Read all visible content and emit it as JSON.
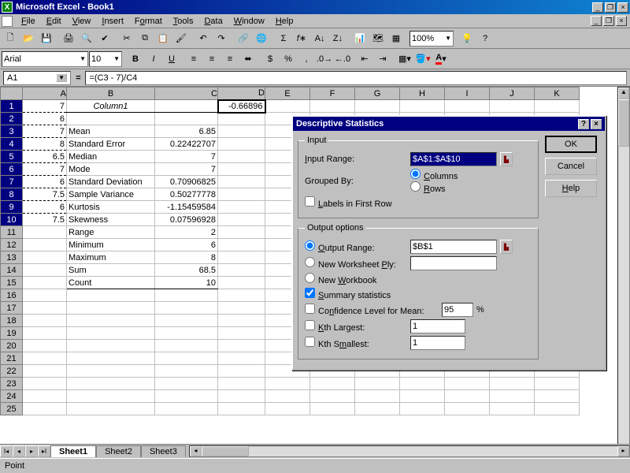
{
  "app": {
    "title": "Microsoft Excel - Book1"
  },
  "menu": {
    "file": "File",
    "edit": "Edit",
    "view": "View",
    "insert": "Insert",
    "format": "Format",
    "tools": "Tools",
    "data": "Data",
    "window": "Window",
    "help": "Help"
  },
  "font": {
    "name": "Arial",
    "size": "10"
  },
  "zoom": "100%",
  "namebox": "A1",
  "formula": "=(C3 - 7)/C4",
  "columns": [
    "A",
    "B",
    "C",
    "D",
    "E",
    "F",
    "G",
    "H",
    "I",
    "J",
    "K"
  ],
  "cells": {
    "A1": "7",
    "A2": "6",
    "A3": "7",
    "A4": "8",
    "A5": "6.5",
    "A6": "7",
    "A7": "6",
    "A8": "7.5",
    "A9": "6",
    "A10": "7.5",
    "B1": "Column1",
    "B3": "Mean",
    "C3": "6.85",
    "B4": "Standard Error",
    "C4": "0.22422707",
    "B5": "Median",
    "C5": "7",
    "B6": "Mode",
    "C6": "7",
    "B7": "Standard Deviation",
    "C7": "0.70906825",
    "B8": "Sample Variance",
    "C8": "0.50277778",
    "B9": "Kurtosis",
    "C9": "-1.15459584",
    "B10": "Skewness",
    "C10": "0.07596928",
    "B11": "Range",
    "C11": "2",
    "B12": "Minimum",
    "C12": "6",
    "B13": "Maximum",
    "C13": "8",
    "B14": "Sum",
    "C14": "68.5",
    "B15": "Count",
    "C15": "10",
    "D1": "-0.66896"
  },
  "sheets": {
    "s1": "Sheet1",
    "s2": "Sheet2",
    "s3": "Sheet3"
  },
  "status": "Point",
  "dialog": {
    "title": "Descriptive Statistics",
    "input_legend": "Input",
    "input_range_lbl": "Input Range:",
    "input_range_val": "$A$1:$A$10",
    "grouped_lbl": "Grouped By:",
    "opt_columns": "Columns",
    "opt_rows": "Rows",
    "labels_first": "Labels in First Row",
    "output_legend": "Output options",
    "output_range_lbl": "Output Range:",
    "output_range_val": "$B$1",
    "new_ws": "New Worksheet Ply:",
    "new_wb": "New Workbook",
    "summary": "Summary statistics",
    "conf_lbl": "Confidence Level for Mean:",
    "conf_val": "95",
    "pct": "%",
    "kth_l": "Kth Largest:",
    "kth_l_val": "1",
    "kth_s": "Kth Smallest:",
    "kth_s_val": "1",
    "ok": "OK",
    "cancel": "Cancel",
    "help": "Help"
  }
}
